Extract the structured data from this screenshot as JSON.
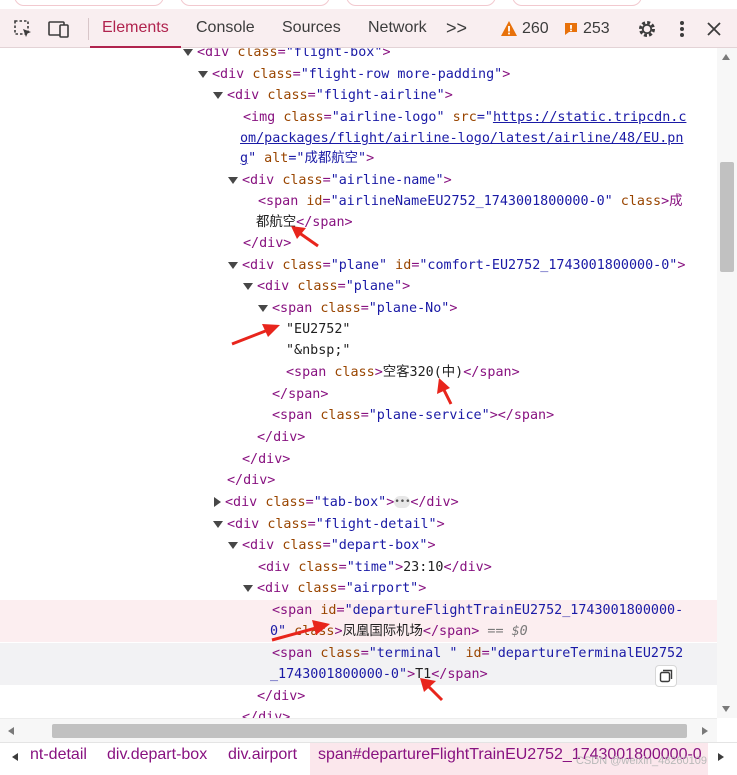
{
  "toolbar": {
    "tabs": [
      "Elements",
      "Console",
      "Sources",
      "Network"
    ],
    "more_label": ">>",
    "warning_count": "260",
    "error_count": "253",
    "icons": [
      "inspect-icon",
      "device-toolbar-icon",
      "warning-icon",
      "error-icon",
      "settings-icon",
      "more-vert-icon",
      "close-icon"
    ],
    "accent_color": "#b0234e"
  },
  "code_lines": [
    {
      "indent": 0,
      "tri": "down",
      "html": "&lt;div <a>class</a>=\"flight-box\"&gt;"
    },
    {
      "indent": 1,
      "tri": "down",
      "html": "&lt;div <a>class</a>=\"flight-row more-padding\"&gt;"
    }
  ],
  "dom": {
    "l01": {
      "t1": "<div ",
      "a1": "class",
      "v1": "\"flight-box\"",
      "t2": ">"
    },
    "l02": {
      "t1": "<div ",
      "a1": "class",
      "v1": "\"flight-row more-padding\"",
      "t2": ">"
    },
    "l03": {
      "t1": "<div ",
      "a1": "class",
      "v1": "\"flight-airline\"",
      "t2": ">"
    },
    "l04": {
      "t1": "<img ",
      "a1": "class",
      "v1": "\"airline-logo\"",
      "a2": " src",
      "v2a": "=\"",
      "link1": "https://static.tripcdn.c"
    },
    "l05": {
      "link2": "om/packages/flight/airline-logo/latest/airline/48/EU.pn"
    },
    "l06": {
      "link3": "g",
      "v3": "\"",
      "a3": " alt",
      "v4": "=\"成都航空\"",
      "t2": ">"
    },
    "l07": {
      "t1": "<div ",
      "a1": "class",
      "v1": "\"airline-name\"",
      "t2": ">"
    },
    "l08": {
      "t1": "<span ",
      "a1": "id",
      "v1": "\"airlineNameEU2752_1743001800000-0\"",
      "a2": " class",
      "t2": ">成"
    },
    "l09": {
      "tx": "都航空",
      "t2": "</span>"
    },
    "l10": {
      "t2": "</div>"
    },
    "l11": {
      "t1": "<div ",
      "a1": "class",
      "v1": "\"plane\"",
      "a2": " id",
      "v2": "\"comfort-EU2752_1743001800000-0\"",
      "t2": ">"
    },
    "l12": {
      "t1": "<div ",
      "a1": "class",
      "v1": "\"plane\"",
      "t2": ">"
    },
    "l13": {
      "t1": "<span ",
      "a1": "class",
      "v1": "\"plane-No\"",
      "t2": ">"
    },
    "l14": {
      "tx": "\"EU2752\""
    },
    "l15": {
      "tx": "\"&nbsp;\""
    },
    "l16": {
      "t1": "<span ",
      "a1": "class",
      "t2": ">",
      "tx": "空客320(中)",
      "t3": "</span>"
    },
    "l17": {
      "t2": "</span>"
    },
    "l18": {
      "t1": "<span ",
      "a1": "class",
      "v1": "\"plane-service\"",
      "t2": "></span>"
    },
    "l19": {
      "t2": "</div>"
    },
    "l20": {
      "t2": "</div>"
    },
    "l21": {
      "t2": "</div>"
    },
    "l22": {
      "t1": "<div ",
      "a1": "class",
      "v1": "\"tab-box\"",
      "t2": ">",
      "ell": "•••",
      "t3": "</div>"
    },
    "l23": {
      "t1": "<div ",
      "a1": "class",
      "v1": "\"flight-detail\"",
      "t2": ">"
    },
    "l24": {
      "t1": "<div ",
      "a1": "class",
      "v1": "\"depart-box\"",
      "t2": ">"
    },
    "l25": {
      "t1": "<div ",
      "a1": "class",
      "v1": "\"time\"",
      "t2": ">",
      "tx": "23:10",
      "t3": "</div>"
    },
    "l26": {
      "t1": "<div ",
      "a1": "class",
      "v1": "\"airport\"",
      "t2": ">"
    },
    "l27": {
      "t1": "<span ",
      "a1": "id",
      "v1": "\"departureFlightTrainEU2752_1743001800000-"
    },
    "l28": {
      "v1": "0\"",
      "a1": " class",
      "t2": ">",
      "tx": "凤凰国际机场",
      "t3": "</span>",
      "dim": " == $0"
    },
    "l29": {
      "t1": "<span ",
      "a1": "class",
      "v1": "\"terminal \"",
      "a2": " id",
      "v2": "\"departureTerminalEU2752"
    },
    "l30": {
      "v1": "_1743001800000-0\"",
      "t2": ">",
      "tx": "T1",
      "t3": "</span>"
    },
    "l31": {
      "t2": "</div>"
    },
    "l32": {
      "t2": "</div>"
    }
  },
  "breadcrumb": [
    "nt-detail",
    "div.depart-box",
    "div.airport",
    "span#departureFlightTrainEU2752_1743001800000-0"
  ],
  "watermark": "CSDN @weixin_48260109"
}
